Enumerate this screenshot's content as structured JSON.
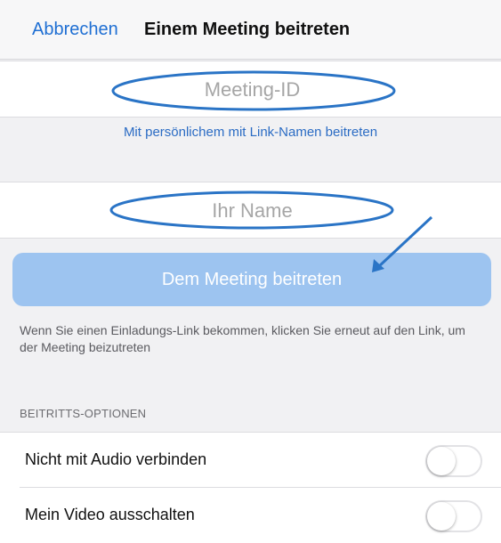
{
  "header": {
    "cancel_label": "Abbrechen",
    "title": "Einem Meeting beitreten"
  },
  "meeting_id": {
    "placeholder": "Meeting-ID",
    "value": ""
  },
  "personal_link": {
    "label": "Mit persönlichem mit Link-Namen beitreten"
  },
  "name": {
    "placeholder": "Ihr Name",
    "value": ""
  },
  "join_button": {
    "label": "Dem Meeting beitreten",
    "color": "#9dc4f0"
  },
  "hint_text": "Wenn Sie einen Einladungs-Link bekommen, klicken Sie erneut auf den Link, um der Meeting beizutreten",
  "options": {
    "header": "BEITRITTS-OPTIONEN",
    "items": [
      {
        "label": "Nicht mit Audio verbinden",
        "enabled": false
      },
      {
        "label": "Mein Video ausschalten",
        "enabled": false
      }
    ]
  },
  "colors": {
    "accent": "#1f6fd3",
    "annotation": "#2a74c6"
  }
}
